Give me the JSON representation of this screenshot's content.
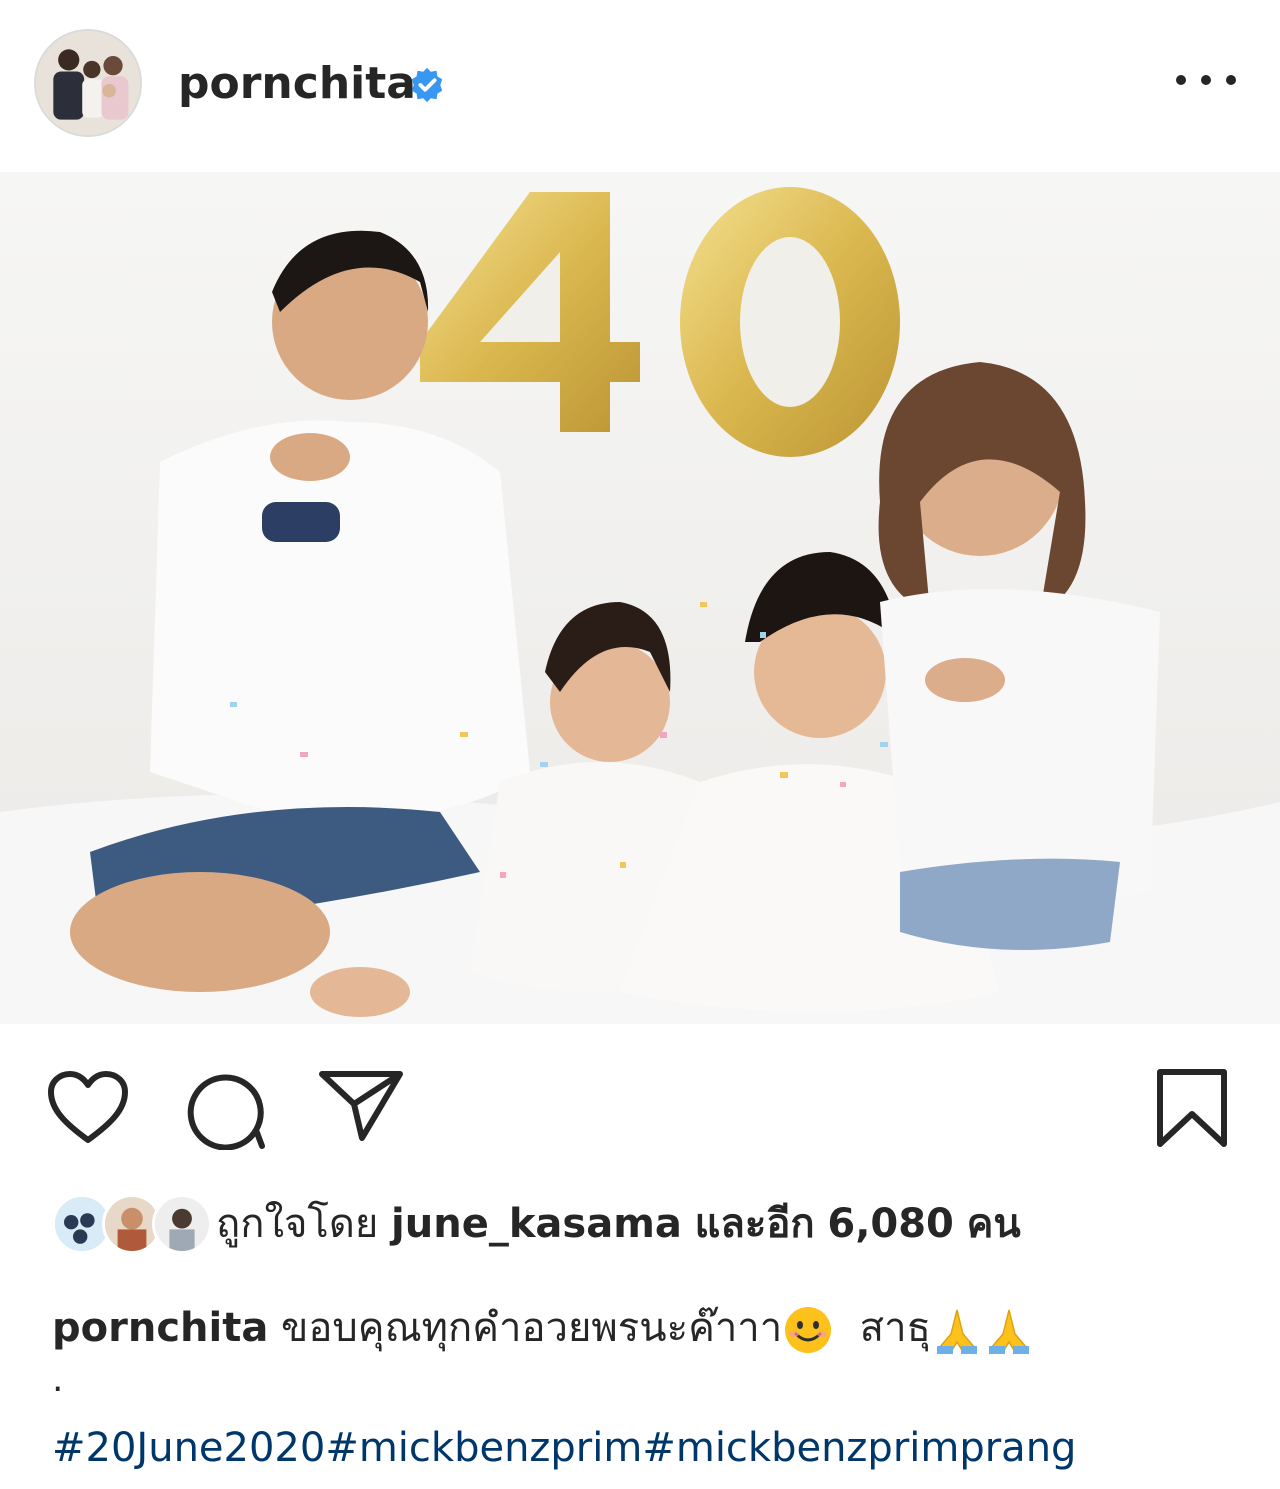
{
  "post": {
    "username": "pornchita",
    "verified": true,
    "avatar_alt": "family-avatar",
    "photo": {
      "balloon_text": "40",
      "colors": {
        "balloon": "#e6c25a",
        "backdrop": "#f2f1ef"
      }
    },
    "actions": {
      "like_icon": "heart-icon",
      "comment_icon": "comment-icon",
      "share_icon": "paper-plane-icon",
      "save_icon": "bookmark-icon"
    },
    "likes": {
      "prefix": "ถูกใจโดย",
      "user": "june_kasama",
      "middle": "และอีก",
      "count": "6,080",
      "suffix": "คน"
    },
    "caption": {
      "username": "pornchita",
      "text": "ขอบคุณทุกคำอวยพรนะค๊าาา",
      "text2": "สาธุ",
      "emojis": [
        "smiling-face-emoji",
        "folded-hands-emoji",
        "folded-hands-emoji"
      ]
    },
    "caption_dot": ".",
    "hashtags": "#20June2020#mickbenzprim#mickbenzprimprang"
  },
  "colors": {
    "text": "#262626",
    "hashtag": "#00376b",
    "verified_badge": "#3897f0"
  }
}
